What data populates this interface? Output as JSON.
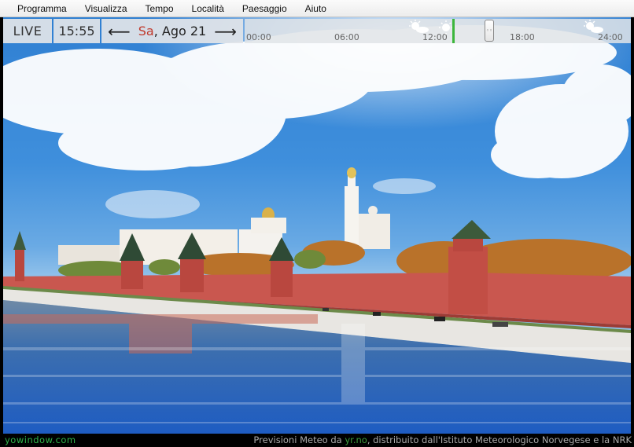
{
  "menu": {
    "items": [
      "Programma",
      "Visualizza",
      "Tempo",
      "Località",
      "Paesaggio",
      "Aiuto"
    ]
  },
  "toolbar": {
    "live_label": "LIVE",
    "time": "15:55",
    "day": "Sa",
    "date": ", Ago 21",
    "timeline_labels": [
      "00:00",
      "06:00",
      "12:00",
      "18:00",
      "24:00"
    ]
  },
  "status": {
    "brand": "yowindow.com",
    "credit_prefix": "Previsioni Meteo da ",
    "credit_link": "yr.no",
    "credit_suffix": ", distribuito dall'Istituto Meteorologico Norvegese e la NRK"
  },
  "icons": {
    "prev": "arrow-left-icon",
    "next": "arrow-right-icon",
    "weather": "sun-cloud-icon"
  },
  "colors": {
    "brand": "#2eb34a",
    "day": "#c0392b",
    "now_marker": "#3cb63c",
    "sky": "#3f8fdc",
    "kremlin_wall": "#c9574f"
  }
}
